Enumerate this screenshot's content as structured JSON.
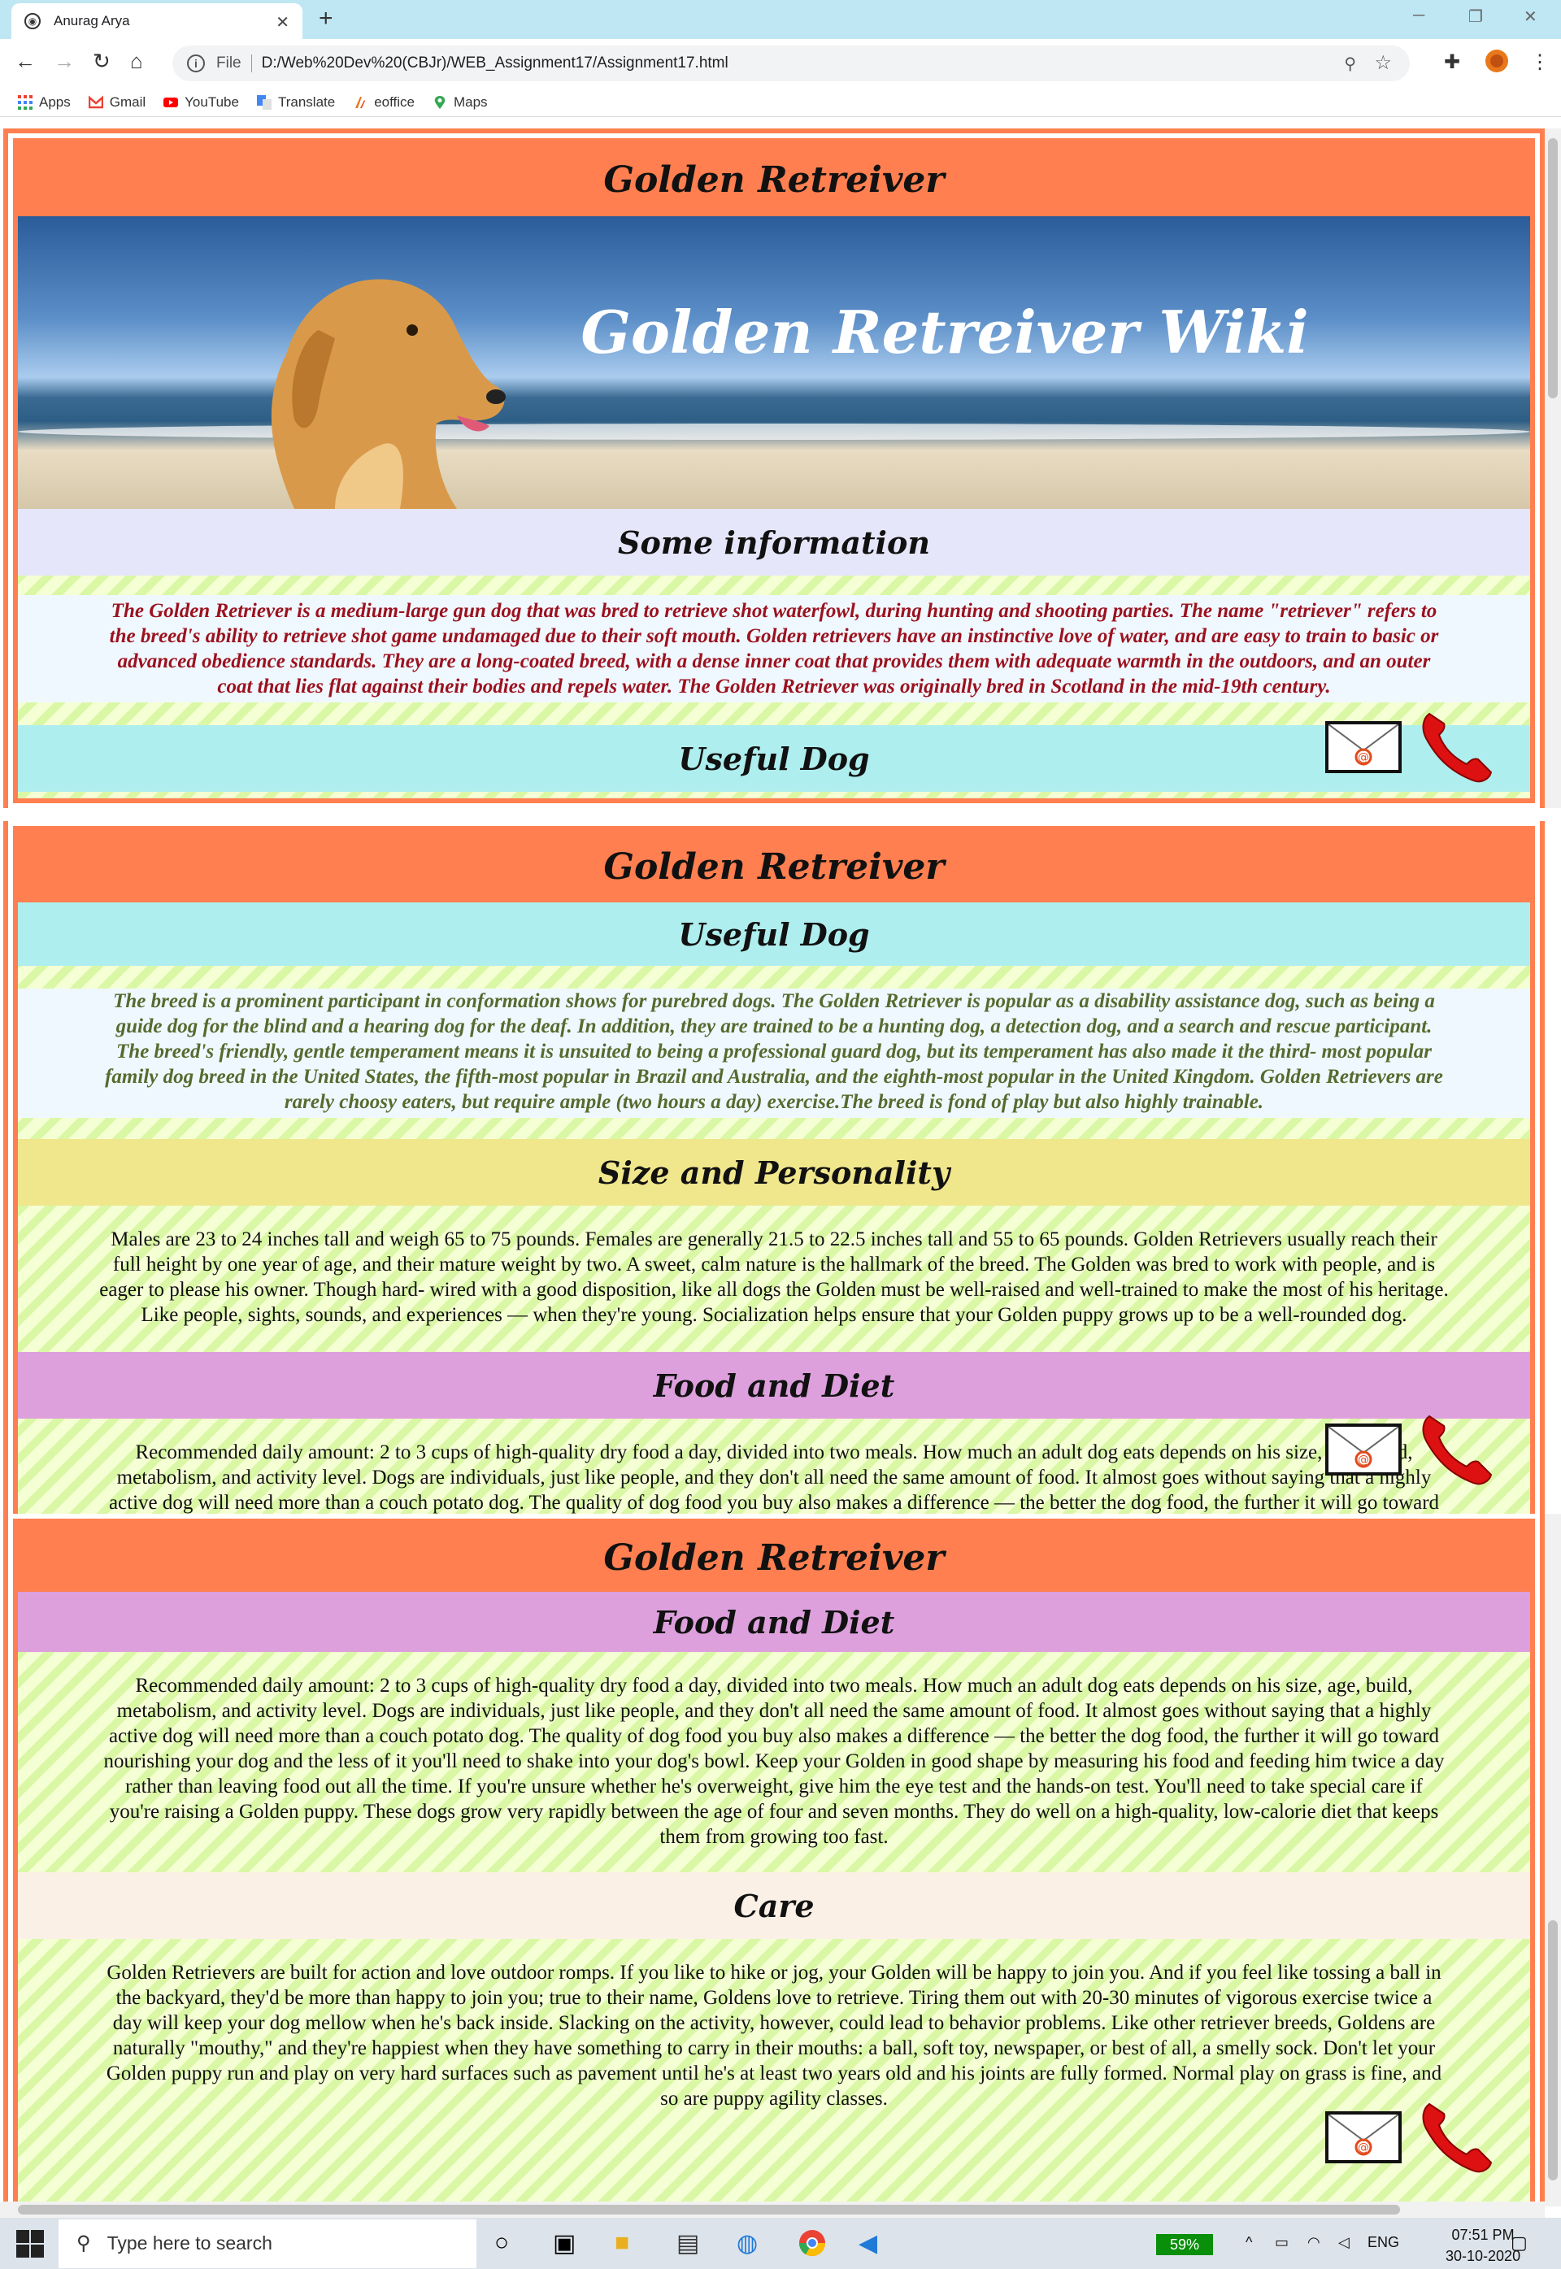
{
  "browser": {
    "tab_title": "Anurag Arya",
    "tab_close": "✕",
    "new_tab": "+",
    "address_prefix": "File",
    "url": "D:/Web%20Dev%20(CBJr)/WEB_Assignment17/Assignment17.html",
    "bookmarks": [
      "Apps",
      "Gmail",
      "YouTube",
      "Translate",
      "eoffice",
      "Maps"
    ]
  },
  "page": {
    "main_heading": "Golden Retreiver",
    "banner_title": "Golden Retreiver Wiki",
    "sections": {
      "info": {
        "heading": "Some information",
        "heading_color": "#e6e6fa",
        "body": "The Golden Retriever is a medium-large gun dog that was bred to retrieve shot waterfowl, during hunting and shooting parties. The name \"retriever\" refers to the breed's ability to retrieve shot game undamaged due to their soft mouth. Golden retrievers have an instinctive love of water, and are easy to train to basic or advanced obedience standards. They are a long-coated breed, with a dense inner coat that provides them with adequate warmth in the outdoors, and an outer coat that lies flat against their bodies and repels water. The Golden Retriever was originally bred in Scotland in the mid-19th century."
      },
      "useful": {
        "heading": "Useful Dog",
        "heading_color": "#afeeee",
        "body": "The breed is a prominent participant in conformation shows for purebred dogs. The Golden Retriever is popular as a disability assistance dog, such as being a guide dog for the blind and a hearing dog for the deaf. In addition, they are trained to be a hunting dog, a detection dog, and a search and rescue participant. The breed's friendly, gentle temperament means it is unsuited to being a professional guard dog, but its temperament has also made it the third- most popular family dog breed in the United States, the fifth-most popular in Brazil and Australia, and the eighth-most popular in the United Kingdom. Golden Retrievers are rarely choosy eaters, but require ample (two hours a day) exercise.The breed is fond of play but also highly trainable."
      },
      "size": {
        "heading": "Size and Personality",
        "heading_color": "#f0e68c",
        "body": "Males are 23 to 24 inches tall and weigh 65 to 75 pounds. Females are generally 21.5 to 22.5 inches tall and 55 to 65 pounds. Golden Retrievers usually reach their full height by one year of age, and their mature weight by two. A sweet, calm nature is the hallmark of the breed. The Golden was bred to work with people, and is eager to please his owner. Though hard- wired with a good disposition, like all dogs the Golden must be well-raised and well-trained to make the most of his heritage. Like people, sights, sounds, and experiences — when they're young. Socialization helps ensure that your Golden puppy grows up to be a well-rounded dog."
      },
      "food": {
        "heading": "Food and Diet",
        "heading_color": "#dda0dd",
        "body": "Recommended daily amount: 2 to 3 cups of high-quality dry food a day, divided into two meals. How much an adult dog eats depends on his size, age, build, metabolism, and activity level. Dogs are individuals, just like people, and they don't all need the same amount of food. It almost goes without saying that a highly active dog will need more than a couch potato dog. The quality of dog food you buy also makes a difference — the better the dog food, the further it will go toward nourishing your dog and the less of it you'll need to shake into your dog's bowl. Keep your Golden in good shape by measuring his food and feeding him twice a day rather than leaving food out all the time. If you're unsure whether he's overweight, give him the eye test and the hands-on test. You'll need to take special care if you're raising a Golden puppy. These dogs grow very rapidly between the age of four and seven months. They do well on a high-quality, low-calorie diet that keeps them from growing too fast."
      },
      "care": {
        "heading": "Care",
        "heading_color": "#faf0e6",
        "body": "Golden Retrievers are built for action and love outdoor romps. If you like to hike or jog, your Golden will be happy to join you. And if you feel like tossing a ball in the backyard, they'd be more than happy to join you; true to their name, Goldens love to retrieve. Tiring them out with 20-30 minutes of vigorous exercise twice a day will keep your dog mellow when he's back inside. Slacking on the activity, however, could lead to behavior problems. Like other retriever breeds, Goldens are naturally \"mouthy,\" and they're happiest when they have something to carry in their mouths: a ball, soft toy, newspaper, or best of all, a smelly sock. Don't let your Golden puppy run and play on very hard surfaces such as pavement until he's at least two years old and his joints are fully formed. Normal play on grass is fine, and so are puppy agility classes."
      }
    },
    "accent_color": "#ff7f50"
  },
  "taskbar": {
    "search_placeholder": "Type here to search",
    "battery": "59%",
    "language": "ENG",
    "time": "07:51 PM",
    "date": "30-10-2020"
  }
}
